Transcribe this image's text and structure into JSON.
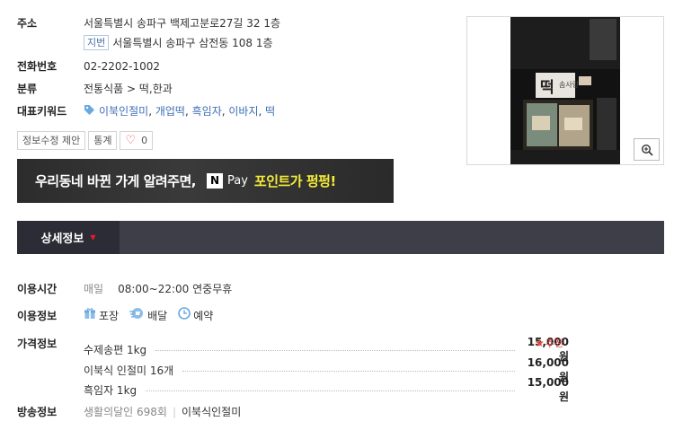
{
  "info": {
    "address_label": "주소",
    "address": "서울특별시 송파구 백제고분로27길 32 1층",
    "jibun_tag": "지번",
    "jibun_address": "서울특별시 송파구 삼전동 108 1층",
    "phone_label": "전화번호",
    "phone": "02-2202-1002",
    "category_label": "분류",
    "category": "전통식품 > 떡,한과",
    "keyword_label": "대표키워드",
    "keywords": [
      "이북인절미",
      "개업떡",
      "흑임자",
      "이바지",
      "떡"
    ]
  },
  "actions": {
    "suggest_edit": "정보수정 제안",
    "stats": "통계",
    "like_count": "0"
  },
  "banner": {
    "text1": "우리동네 바뀐 가게 알려주면,",
    "npay_logo": "N",
    "pay": "Pay",
    "text2": "포인트가 펑펑!"
  },
  "tabs": {
    "active": "상세정보"
  },
  "detail": {
    "hours_label": "이용시간",
    "hours_prefix": "매일",
    "hours": "08:00~22:00 연중무휴",
    "usage_label": "이용정보",
    "services": [
      {
        "icon": "gift-box-icon",
        "label": "포장"
      },
      {
        "icon": "delivery-icon",
        "label": "배달"
      },
      {
        "icon": "clock-icon",
        "label": "예약"
      }
    ],
    "price_label": "가격정보",
    "prices": [
      {
        "name": "수제송편 1kg",
        "price": "15,000원",
        "badge": "추천"
      },
      {
        "name": "이북식 인절미 16개",
        "price": "16,000원"
      },
      {
        "name": "흑임자 1kg",
        "price": "15,000원"
      }
    ],
    "broadcast_label": "방송정보",
    "broadcast_show": "생활의달인 698회",
    "broadcast_item": "이북식인절미"
  },
  "photo": {
    "sign_text": "떡",
    "sign_small": "솜사랑"
  },
  "colors": {
    "accent_red": "#e8192c",
    "link_blue": "#3d6fb6",
    "tabbar": "#3d3e48",
    "npay_yellow": "#f7ec3a"
  }
}
